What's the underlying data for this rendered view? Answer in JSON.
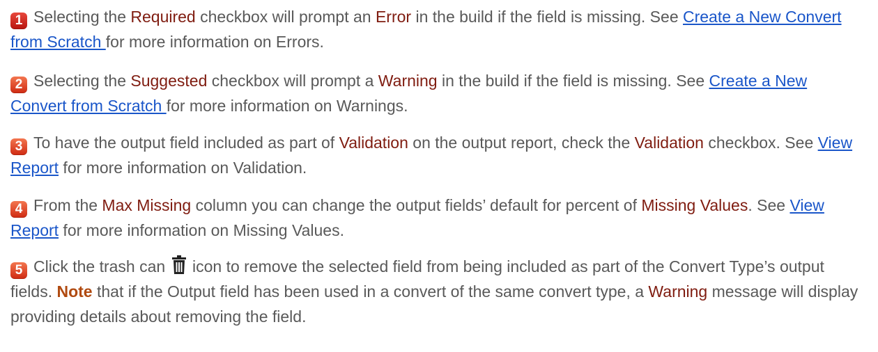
{
  "items": [
    {
      "badge": "1",
      "parts": [
        {
          "t": "Selecting the "
        },
        {
          "t": "Required",
          "c": "red"
        },
        {
          "t": " checkbox will prompt an "
        },
        {
          "t": "Error",
          "c": "red"
        },
        {
          "t": " in the build if the field is missing. See "
        },
        {
          "t": "Create a New Convert from Scratch ",
          "c": "link"
        },
        {
          "t": "for more information on Errors."
        }
      ]
    },
    {
      "badge": "2",
      "parts": [
        {
          "t": "Selecting the "
        },
        {
          "t": "Suggested",
          "c": "red"
        },
        {
          "t": " checkbox will prompt a "
        },
        {
          "t": "Warning",
          "c": "red"
        },
        {
          "t": " in the build if the field is missing. See "
        },
        {
          "t": "Create a New Convert from Scratch ",
          "c": "link"
        },
        {
          "t": "for more information on Warnings."
        }
      ]
    },
    {
      "badge": "3",
      "parts": [
        {
          "t": "To have the output field included as part of "
        },
        {
          "t": "Validation",
          "c": "red"
        },
        {
          "t": " on the output report, check the "
        },
        {
          "t": "Validation",
          "c": "red"
        },
        {
          "t": " checkbox.  See "
        },
        {
          "t": "View Report",
          "c": "link"
        },
        {
          "t": " for more information on Validation."
        }
      ]
    },
    {
      "badge": "4",
      "parts": [
        {
          "t": "From the "
        },
        {
          "t": "Max Missing",
          "c": "red"
        },
        {
          "t": " column you can change the output fields’ default for percent of "
        },
        {
          "t": "Missing Values",
          "c": "red"
        },
        {
          "t": ". See "
        },
        {
          "t": "View Report",
          "c": "link"
        },
        {
          "t": " for more information on Missing Values."
        }
      ]
    },
    {
      "badge": "5",
      "parts": [
        {
          "t": "Click the trash can "
        },
        {
          "icon": "trash-icon"
        },
        {
          "t": " icon to remove the selected field from being included as part of the Convert Type’s output fields.  "
        },
        {
          "t": "Note",
          "c": "bold"
        },
        {
          "t": " that if the Output field has been used in a convert of the same convert type, a "
        },
        {
          "t": "Warning",
          "c": "red"
        },
        {
          "t": " message will display providing details about removing the field."
        }
      ]
    }
  ]
}
